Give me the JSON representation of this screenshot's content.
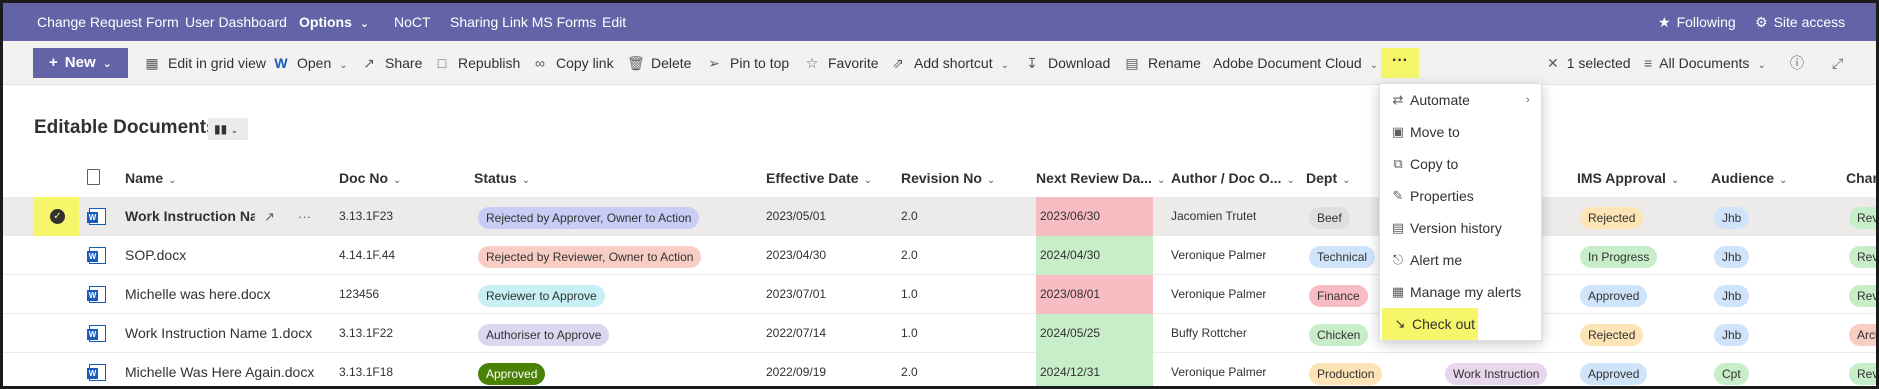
{
  "topnav": {
    "items": [
      "Change Request Form",
      "User Dashboard",
      "Options",
      "NoCT",
      "Sharing Link MS Forms",
      "Edit"
    ],
    "following": "Following",
    "site_access": "Site access"
  },
  "toolbar": {
    "new_label": "New",
    "edit_grid": "Edit in grid view",
    "open": "Open",
    "share": "Share",
    "republish": "Republish",
    "copy_link": "Copy link",
    "delete": "Delete",
    "pin_to_top": "Pin to top",
    "favorite": "Favorite",
    "add_shortcut": "Add shortcut",
    "download": "Download",
    "rename": "Rename",
    "adobe": "Adobe Document Cloud",
    "more": "···",
    "selected": "1 selected",
    "all_documents": "All Documents"
  },
  "page": {
    "title": "Editable Documents"
  },
  "table": {
    "columns": [
      "Name",
      "Doc No",
      "Status",
      "Effective Date",
      "Revision No",
      "Next Review Da...",
      "Author / Doc O...",
      "Dept",
      "IMS Approval",
      "Audience",
      "Chan"
    ],
    "rows": [
      {
        "name": "Work Instruction Na...",
        "doc_no": "3.13.1F23",
        "status": "Rejected by Approver, Owner to Action",
        "effective": "2023/05/01",
        "revision": "2.0",
        "next_review": "2023/06/30",
        "author": "Jacomien Trutet",
        "dept": "Beef",
        "doc_type": "",
        "ims": "Rejected",
        "audience": "Jhb",
        "chan": "Rev"
      },
      {
        "name": "SOP.docx",
        "doc_no": "4.14.1F.44",
        "status": "Rejected by Reviewer, Owner to Action",
        "effective": "2023/04/30",
        "revision": "2.0",
        "next_review": "2024/04/30",
        "author": "Veronique Palmer",
        "dept": "Technical",
        "doc_type": "",
        "ims": "In Progress",
        "audience": "Jhb",
        "chan": "Rev"
      },
      {
        "name": "Michelle was here.docx",
        "doc_no": "123456",
        "status": "Reviewer to Approve",
        "effective": "2023/07/01",
        "revision": "1.0",
        "next_review": "2023/08/01",
        "author": "Veronique Palmer",
        "dept": "Finance",
        "doc_type": "",
        "ims": "Approved",
        "audience": "Jhb",
        "chan": "Rev"
      },
      {
        "name": "Work Instruction Name 1.docx",
        "doc_no": "3.13.1F22",
        "status": "Authoriser to Approve",
        "effective": "2022/07/14",
        "revision": "1.0",
        "next_review": "2024/05/25",
        "author": "Buffy Rottcher",
        "dept": "Chicken",
        "doc_type": "",
        "ims": "Rejected",
        "audience": "Jhb",
        "chan": "Arch"
      },
      {
        "name": "Michelle Was Here Again.docx",
        "doc_no": "3.13.1F18",
        "status": "Approved",
        "effective": "2022/09/19",
        "revision": "2.0",
        "next_review": "2024/12/31",
        "author": "Veronique Palmer",
        "dept": "Production",
        "doc_type": "Work Instruction",
        "ims": "Approved",
        "audience": "Cpt",
        "chan": "Rev"
      }
    ]
  },
  "menu": {
    "items": [
      "Automate",
      "Move to",
      "Copy to",
      "Properties",
      "Version history",
      "Alert me",
      "Manage my alerts",
      "Check out"
    ]
  },
  "colors": {
    "brand": "#6264a7",
    "highlight": "#f6f66b",
    "overdue": "#f8bcc3",
    "ok": "#c8eec9"
  }
}
